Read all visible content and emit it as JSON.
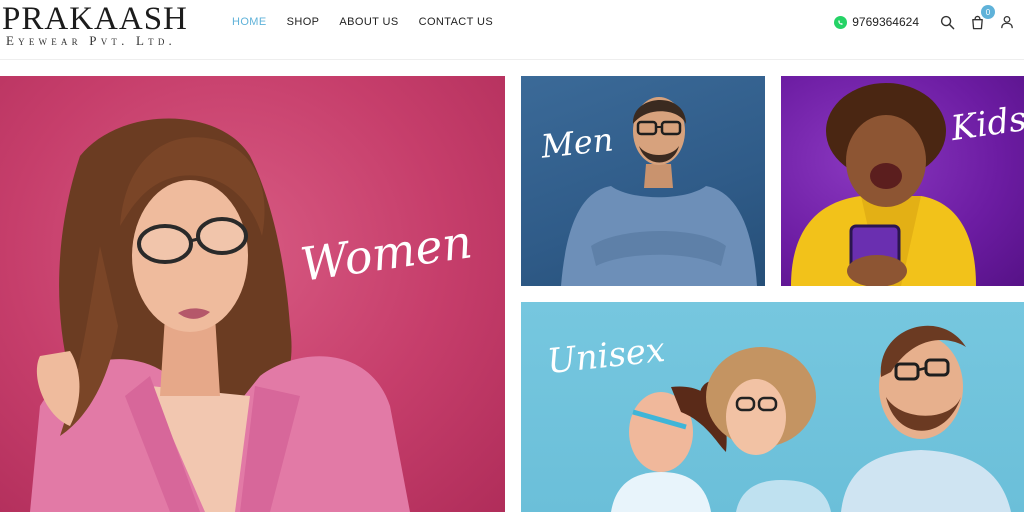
{
  "brand": {
    "name": "PRAKAASH",
    "tagline": "Eyewear Pvt. Ltd."
  },
  "nav": {
    "items": [
      {
        "label": "HOME",
        "active": true
      },
      {
        "label": "SHOP",
        "active": false
      },
      {
        "label": "ABOUT US",
        "active": false
      },
      {
        "label": "CONTACT US",
        "active": false
      }
    ]
  },
  "contact": {
    "phone": "9769364624",
    "icon": "whatsapp-icon"
  },
  "cart": {
    "count": "0"
  },
  "icons": [
    "search-icon",
    "cart-icon",
    "user-icon"
  ],
  "categories": {
    "women": "Women",
    "men": "Men",
    "kids": "Kids",
    "unisex": "Unisex"
  },
  "colors": {
    "accent": "#5fb2d9",
    "women_bg": "#c63e6b",
    "men_bg": "#2f5b88",
    "kids_bg": "#6c1ca2",
    "unisex_bg": "#6bbfd9",
    "whatsapp": "#25d366"
  }
}
